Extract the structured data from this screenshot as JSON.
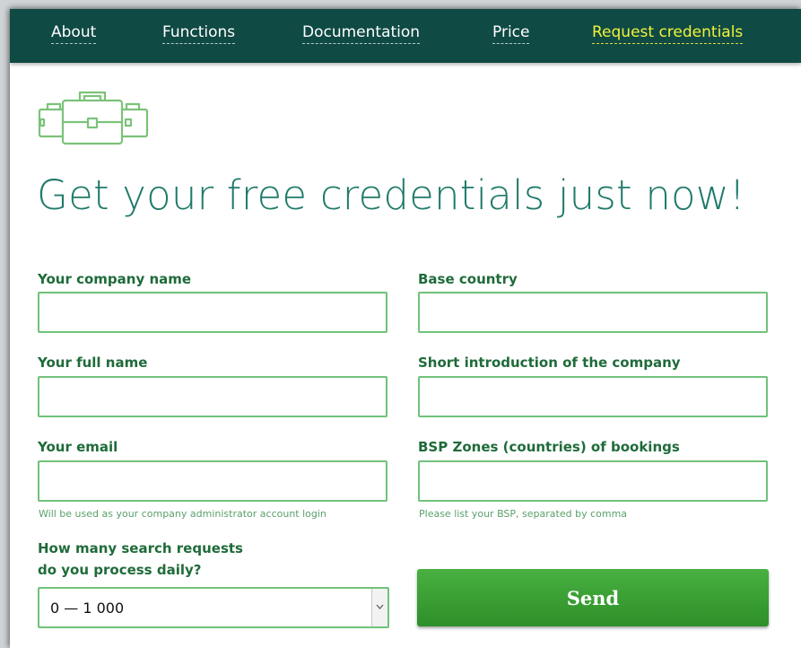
{
  "nav": {
    "items": [
      {
        "label": "About"
      },
      {
        "label": "Functions"
      },
      {
        "label": "Documentation"
      },
      {
        "label": "Price"
      },
      {
        "label": "Request credentials",
        "active": true
      }
    ]
  },
  "logo": {
    "icon": "briefcases-icon"
  },
  "headline": "Get your free credentials just now!",
  "form": {
    "company_name": {
      "label": "Your company name",
      "value": "",
      "placeholder": ""
    },
    "base_country": {
      "label": "Base country",
      "value": "",
      "placeholder": ""
    },
    "full_name": {
      "label": "Your full name",
      "value": "",
      "placeholder": ""
    },
    "intro": {
      "label": "Short introduction of the company",
      "value": "",
      "placeholder": ""
    },
    "email": {
      "label": "Your email",
      "value": "",
      "placeholder": "",
      "hint": "Will be used as your company administrator account login"
    },
    "bsp_zones": {
      "label": "BSP Zones (countries) of bookings",
      "value": "",
      "placeholder": "",
      "hint": "Please list your BSP, separated by comma"
    },
    "requests": {
      "label_line1": "How many search requests",
      "label_line2": "do you process daily?",
      "selected": "0 — 1 000"
    },
    "send_label": "Send"
  },
  "colors": {
    "nav_bg": "#0f4a44",
    "nav_active": "#f2f33b",
    "headline": "#1f7a6a",
    "label": "#1f6b3a",
    "field_border": "#70c27a",
    "button": "#3aa035"
  }
}
